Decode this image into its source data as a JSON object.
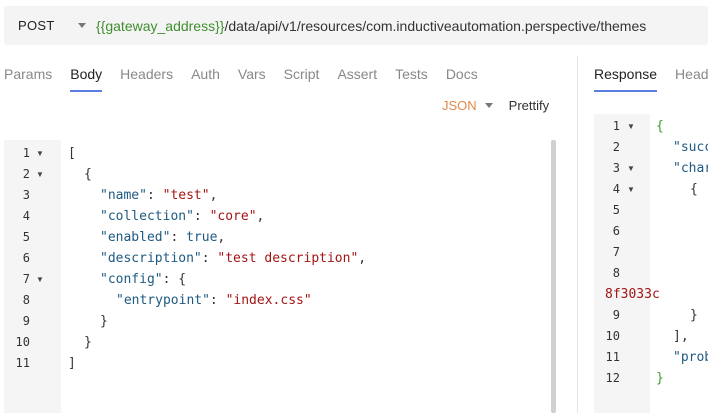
{
  "request": {
    "method": "POST",
    "url_var": "{{gateway_address}}",
    "url_path": "/data/api/v1/resources/com.inductiveautomation.perspective/themes"
  },
  "tabs": [
    {
      "label": "Params",
      "active": false
    },
    {
      "label": "Body",
      "active": true
    },
    {
      "label": "Headers",
      "active": false
    },
    {
      "label": "Auth",
      "active": false
    },
    {
      "label": "Vars",
      "active": false
    },
    {
      "label": "Script",
      "active": false
    },
    {
      "label": "Assert",
      "active": false
    },
    {
      "label": "Tests",
      "active": false
    },
    {
      "label": "Docs",
      "active": false
    }
  ],
  "body_options": {
    "mode": "JSON",
    "prettify": "Prettify"
  },
  "response_tabs": [
    {
      "label": "Response",
      "active": true
    },
    {
      "label": "Head",
      "active": false
    }
  ],
  "request_body": {
    "lines": [
      {
        "n": "1",
        "fold": true,
        "indent": 0,
        "parts": [
          [
            "p",
            "["
          ]
        ]
      },
      {
        "n": "2",
        "fold": true,
        "indent": 1,
        "parts": [
          [
            "p",
            "{"
          ]
        ]
      },
      {
        "n": "3",
        "fold": false,
        "indent": 2,
        "parts": [
          [
            "k",
            "\"name\""
          ],
          [
            "p",
            ": "
          ],
          [
            "s",
            "\"test\""
          ],
          [
            "p",
            ","
          ]
        ]
      },
      {
        "n": "4",
        "fold": false,
        "indent": 2,
        "parts": [
          [
            "k",
            "\"collection\""
          ],
          [
            "p",
            ": "
          ],
          [
            "s",
            "\"core\""
          ],
          [
            "p",
            ","
          ]
        ]
      },
      {
        "n": "5",
        "fold": false,
        "indent": 2,
        "parts": [
          [
            "k",
            "\"enabled\""
          ],
          [
            "p",
            ": "
          ],
          [
            "b",
            "true"
          ],
          [
            "p",
            ","
          ]
        ]
      },
      {
        "n": "6",
        "fold": false,
        "indent": 2,
        "parts": [
          [
            "k",
            "\"description\""
          ],
          [
            "p",
            ": "
          ],
          [
            "s",
            "\"test description\""
          ],
          [
            "p",
            ","
          ]
        ]
      },
      {
        "n": "7",
        "fold": true,
        "indent": 2,
        "parts": [
          [
            "k",
            "\"config\""
          ],
          [
            "p",
            ": {"
          ]
        ]
      },
      {
        "n": "8",
        "fold": false,
        "indent": 3,
        "parts": [
          [
            "k",
            "\"entrypoint\""
          ],
          [
            "p",
            ": "
          ],
          [
            "s",
            "\"index.css\""
          ]
        ]
      },
      {
        "n": "9",
        "fold": false,
        "indent": 2,
        "parts": [
          [
            "p",
            "}"
          ]
        ]
      },
      {
        "n": "10",
        "fold": false,
        "indent": 1,
        "parts": [
          [
            "p",
            "}"
          ]
        ]
      },
      {
        "n": "11",
        "fold": false,
        "indent": 0,
        "parts": [
          [
            "p",
            "]"
          ]
        ]
      }
    ]
  },
  "response_body": {
    "rows": [
      {
        "n": "1",
        "fold": true,
        "indent": 0,
        "parts": [
          [
            "g",
            "{"
          ]
        ]
      },
      {
        "n": "2",
        "fold": false,
        "indent": 1,
        "parts": [
          [
            "k",
            "\"succ"
          ]
        ]
      },
      {
        "n": "3",
        "fold": true,
        "indent": 1,
        "parts": [
          [
            "k",
            "\"char"
          ]
        ]
      },
      {
        "n": "4",
        "fold": true,
        "indent": 2,
        "parts": [
          [
            "p",
            "{"
          ]
        ]
      },
      {
        "n": "5",
        "fold": false,
        "indent": 3,
        "parts": [
          [
            "k",
            "\""
          ]
        ]
      },
      {
        "n": "6",
        "fold": false,
        "indent": 3,
        "parts": [
          [
            "k",
            "\""
          ]
        ]
      },
      {
        "n": "7",
        "fold": false,
        "indent": 3,
        "parts": [
          [
            "k",
            "\""
          ]
        ]
      },
      {
        "n": "8",
        "fold": false,
        "indent": 3,
        "parts": [
          [
            "k",
            "\""
          ]
        ]
      },
      {
        "n": "",
        "fold": false,
        "indent": -3,
        "parts": [
          [
            "s",
            "8f3033c"
          ]
        ]
      },
      {
        "n": "9",
        "fold": false,
        "indent": 2,
        "parts": [
          [
            "p",
            "}"
          ]
        ]
      },
      {
        "n": "10",
        "fold": false,
        "indent": 1,
        "parts": [
          [
            "p",
            "],"
          ]
        ]
      },
      {
        "n": "11",
        "fold": false,
        "indent": 1,
        "parts": [
          [
            "k",
            "\"prob"
          ]
        ]
      },
      {
        "n": "12",
        "fold": false,
        "indent": 0,
        "parts": [
          [
            "g",
            "}"
          ]
        ]
      }
    ]
  }
}
